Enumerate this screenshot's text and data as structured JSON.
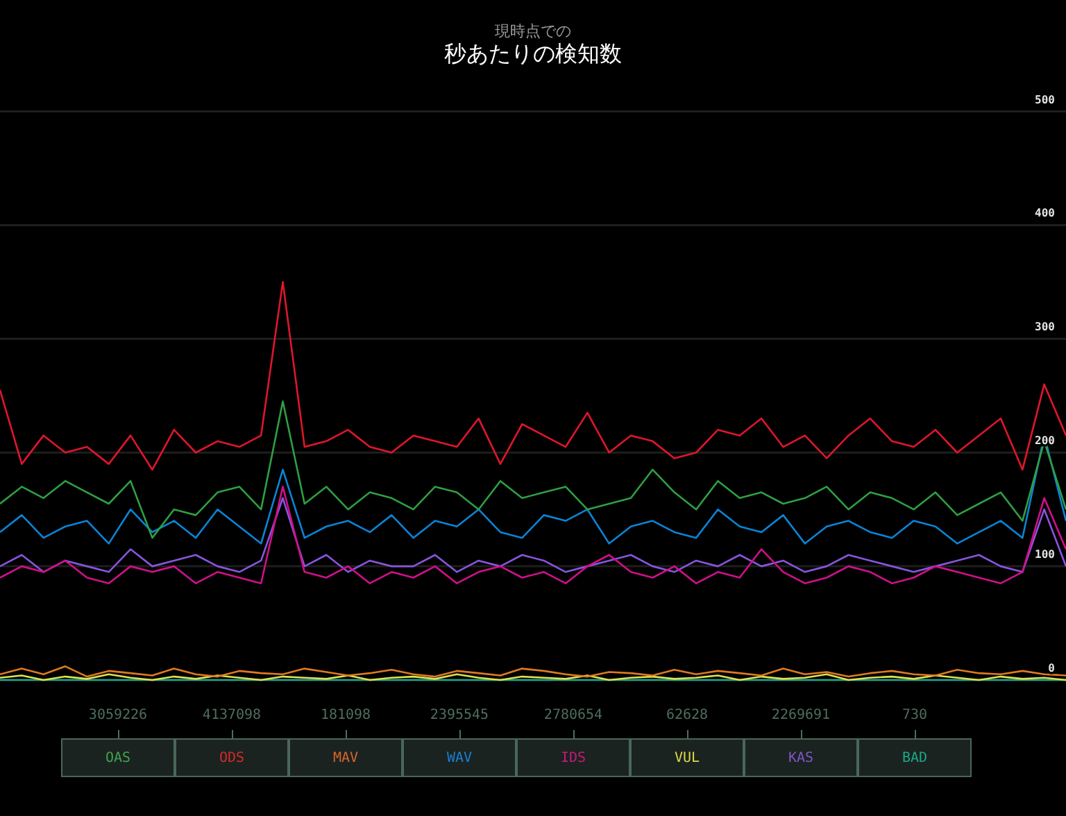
{
  "header": {
    "subtitle": "現時点での",
    "title": "秒あたりの検知数"
  },
  "chart": {
    "chart_data": {
      "type": "line",
      "grid": true,
      "ylim": [
        0,
        598
      ],
      "yticks": [
        0,
        100,
        200,
        300,
        400,
        500
      ],
      "series": [
        {
          "name": "OAS",
          "color": "#2ea043",
          "values": [
            155,
            170,
            160,
            175,
            165,
            155,
            175,
            125,
            150,
            145,
            165,
            170,
            150,
            245,
            155,
            170,
            150,
            165,
            160,
            150,
            170,
            165,
            150,
            175,
            160,
            165,
            170,
            150,
            155,
            160,
            185,
            165,
            150,
            175,
            160,
            165,
            155,
            160,
            170,
            150,
            165,
            160,
            150,
            165,
            145,
            155,
            165,
            140,
            210,
            150
          ]
        },
        {
          "name": "ODS",
          "color": "#e0162b",
          "values": [
            255,
            190,
            215,
            200,
            205,
            190,
            215,
            185,
            220,
            200,
            210,
            205,
            215,
            350,
            205,
            210,
            220,
            205,
            200,
            215,
            210,
            205,
            230,
            190,
            225,
            215,
            205,
            235,
            200,
            215,
            210,
            195,
            200,
            220,
            215,
            230,
            205,
            215,
            195,
            215,
            230,
            210,
            205,
            220,
            200,
            215,
            230,
            185,
            260,
            215
          ]
        },
        {
          "name": "MAV",
          "color": "#e07a20",
          "values": [
            5,
            10,
            5,
            12,
            3,
            8,
            6,
            4,
            10,
            5,
            3,
            8,
            6,
            5,
            10,
            7,
            4,
            6,
            9,
            5,
            3,
            8,
            6,
            4,
            10,
            8,
            5,
            3,
            7,
            6,
            4,
            9,
            5,
            8,
            6,
            4,
            10,
            5,
            7,
            3,
            6,
            8,
            5,
            4,
            9,
            6,
            5,
            8,
            5,
            4
          ]
        },
        {
          "name": "WAV",
          "color": "#0a84d6",
          "values": [
            130,
            145,
            125,
            135,
            140,
            120,
            150,
            130,
            140,
            125,
            150,
            135,
            120,
            185,
            125,
            135,
            140,
            130,
            145,
            125,
            140,
            135,
            150,
            130,
            125,
            145,
            140,
            150,
            120,
            135,
            140,
            130,
            125,
            150,
            135,
            130,
            145,
            120,
            135,
            140,
            130,
            125,
            140,
            135,
            120,
            130,
            140,
            125,
            215,
            140
          ]
        },
        {
          "name": "IDS",
          "color": "#d0108a",
          "values": [
            90,
            100,
            95,
            105,
            90,
            85,
            100,
            95,
            100,
            85,
            95,
            90,
            85,
            170,
            95,
            90,
            100,
            85,
            95,
            90,
            100,
            85,
            95,
            100,
            90,
            95,
            85,
            100,
            110,
            95,
            90,
            100,
            85,
            95,
            90,
            115,
            95,
            85,
            90,
            100,
            95,
            85,
            90,
            100,
            95,
            90,
            85,
            95,
            160,
            115
          ]
        },
        {
          "name": "VUL",
          "color": "#e0e050",
          "values": [
            2,
            4,
            0,
            3,
            1,
            5,
            2,
            0,
            3,
            1,
            4,
            2,
            0,
            3,
            2,
            1,
            4,
            0,
            2,
            3,
            1,
            5,
            2,
            0,
            3,
            2,
            1,
            4,
            0,
            2,
            3,
            1,
            2,
            4,
            0,
            3,
            1,
            2,
            5,
            0,
            2,
            3,
            1,
            4,
            2,
            0,
            3,
            1,
            2,
            0
          ]
        },
        {
          "name": "KAS",
          "color": "#8855dd",
          "values": [
            100,
            110,
            95,
            105,
            100,
            95,
            115,
            100,
            105,
            110,
            100,
            95,
            105,
            160,
            100,
            110,
            95,
            105,
            100,
            100,
            110,
            95,
            105,
            100,
            110,
            105,
            95,
            100,
            105,
            110,
            100,
            95,
            105,
            100,
            110,
            100,
            105,
            95,
            100,
            110,
            105,
            100,
            95,
            100,
            105,
            110,
            100,
            95,
            150,
            100
          ]
        },
        {
          "name": "BAD",
          "color": "#1aa88a",
          "values": [
            0,
            0,
            0,
            0,
            0,
            0,
            0,
            0,
            0,
            0,
            0,
            0,
            0,
            0,
            0,
            0,
            0,
            0,
            0,
            0,
            0,
            0,
            0,
            0,
            0,
            0,
            0,
            0,
            0,
            0,
            0,
            0,
            0,
            0,
            0,
            0,
            0,
            0,
            0,
            0,
            0,
            0,
            0,
            0,
            0,
            0,
            0,
            0,
            0,
            0
          ]
        }
      ]
    }
  },
  "legend": [
    {
      "count": "3059226",
      "color": "#3fa34d"
    },
    {
      "count": "4137098",
      "color": "#d42a2a"
    },
    {
      "count": "181098",
      "color": "#d8642a"
    },
    {
      "count": "2395545",
      "color": "#1a7fd4"
    },
    {
      "count": "2780654",
      "color": "#c8177a"
    },
    {
      "count": "62628",
      "color": "#d8d84a"
    },
    {
      "count": "2269691",
      "color": "#7d55c7"
    },
    {
      "count": "730",
      "color": "#1aa88a"
    }
  ]
}
